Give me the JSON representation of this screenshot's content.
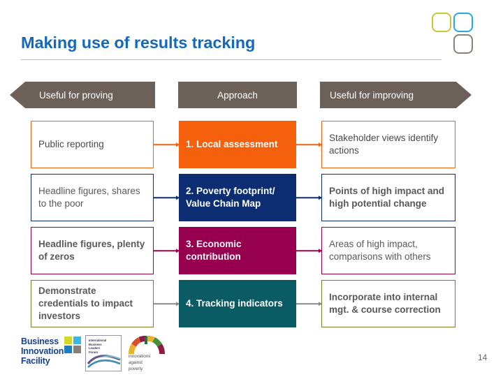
{
  "slide": {
    "title": "Making use of results tracking",
    "page_number": "14",
    "title_color": "#1668b8"
  },
  "logo": {
    "square_yellow": "#c8c832",
    "square_blue": "#29a8df",
    "square_grey": "#8a8278"
  },
  "columns": {
    "banner_color": "#6b6159",
    "left": "Useful for proving",
    "middle": "Approach",
    "right": "Useful for improving"
  },
  "rows": [
    {
      "color": "#f4600c",
      "left": "Public reporting",
      "middle": "1. Local assessment",
      "right": "Stakeholder views identify actions"
    },
    {
      "color": "#0c2d72",
      "left": "Headline figures, shares to the poor",
      "middle": "2. Poverty footprint/ Value Chain Map",
      "right": "Points of high impact and high potential change"
    },
    {
      "color": "#96004f",
      "left": "Headline figures, plenty of zeros",
      "middle": "3. Economic contribution",
      "right": "Areas of high impact, comparisons with others"
    },
    {
      "color": "#0a5b63",
      "border_color": "#7d7c26",
      "connector_color": "#8a8a8a",
      "left": "Demonstrate credentials to impact investors",
      "middle": "4. Tracking indicators",
      "right": "Incorporate into internal mgt. & course correction"
    }
  ],
  "footer": {
    "bif_logo": "Business\nInnovation\nFacility",
    "bif_line_1": "Business",
    "bif_line_2": "Innovation",
    "bif_line_3": "Facility",
    "isd_line_1": "International",
    "isd_line_2": "Business",
    "isd_line_3": "Leaders",
    "isd_line_4": "Forum",
    "iap_line_1": "innovations",
    "iap_line_2": "against",
    "iap_line_3": "poverty"
  }
}
